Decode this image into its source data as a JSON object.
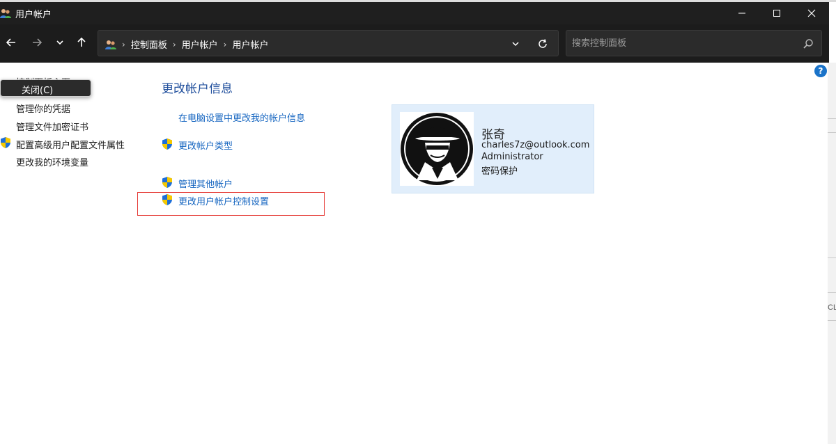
{
  "window": {
    "title": "用户帐户",
    "controls": {
      "minimize": "minimize",
      "maximize": "maximize",
      "close": "close"
    }
  },
  "navigation": {
    "breadcrumb": [
      "控制面板",
      "用户帐户",
      "用户帐户"
    ],
    "search_placeholder": "搜索控制面板"
  },
  "tooltip": {
    "label": "关闭(C)"
  },
  "sidebar": {
    "home_label": "控制面板主页",
    "items": [
      {
        "label": "管理你的凭据",
        "shield": false
      },
      {
        "label": "管理文件加密证书",
        "shield": false
      },
      {
        "label": "配置高级用户配置文件属性",
        "shield": true
      },
      {
        "label": "更改我的环境变量",
        "shield": false
      }
    ]
  },
  "main": {
    "title": "更改帐户信息",
    "tasks": [
      {
        "label": "在电脑设置中更改我的帐户信息",
        "shield": false
      },
      {
        "label": "更改帐户类型",
        "shield": true
      },
      {
        "label": "管理其他帐户",
        "shield": true
      },
      {
        "label": "更改用户帐户控制设置",
        "shield": true,
        "highlighted": true
      }
    ]
  },
  "account": {
    "name": "张奇",
    "email": "charles7z@outlook.com",
    "role": "Administrator",
    "protection": "密码保护"
  },
  "right_fragment": {
    "text": "CL"
  },
  "colors": {
    "titlebar": "#1f1f1f",
    "navbar": "#1c1c1c",
    "link": "#1565c0",
    "heading": "#1f4e9c",
    "card": "#e1eefb",
    "highlight": "#e53935"
  }
}
